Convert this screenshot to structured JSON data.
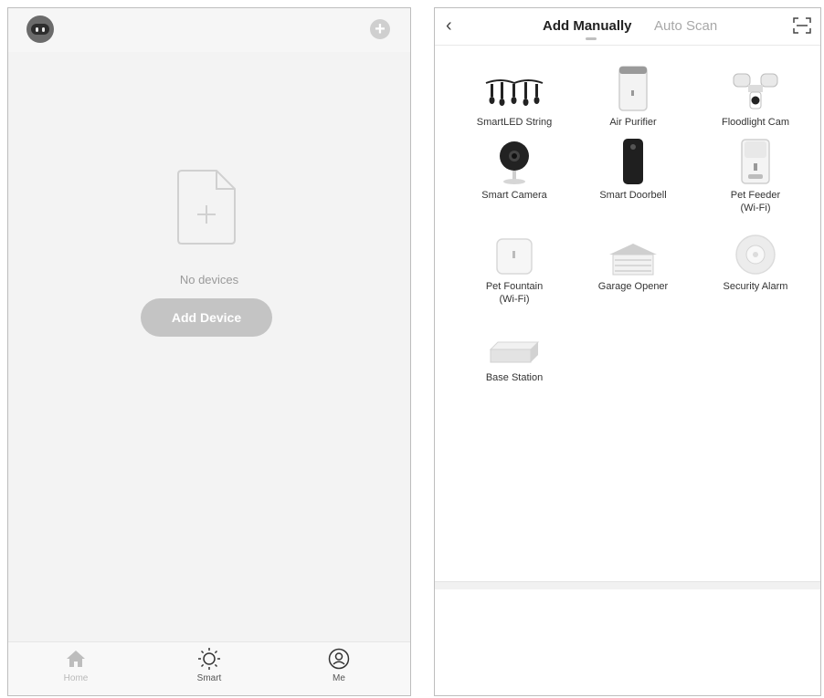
{
  "left_screen": {
    "top_bar": {
      "avatar": "robot-avatar-icon",
      "add_icon": "plus-circle-icon"
    },
    "empty_state": {
      "icon": "add-document-icon",
      "message": "No devices"
    },
    "add_device_button": "Add Device",
    "tab_bar": [
      {
        "label": "Home",
        "icon": "home-icon"
      },
      {
        "label": "Smart",
        "icon": "sun-icon"
      },
      {
        "label": "Me",
        "icon": "user-icon"
      }
    ]
  },
  "right_screen": {
    "header": {
      "back_icon": "chevron-left-icon",
      "active_tab": "Add Manually",
      "inactive_tab": "Auto Scan",
      "scan_icon": "scan-frame-icon"
    },
    "devices": [
      {
        "label": "SmartLED String",
        "icon": "string-lights-icon"
      },
      {
        "label": "Air Purifier",
        "icon": "air-purifier-icon"
      },
      {
        "label": "Floodlight Cam",
        "icon": "floodlight-cam-icon"
      },
      {
        "label": "Smart Camera",
        "icon": "smart-camera-icon"
      },
      {
        "label": "Smart Doorbell",
        "icon": "doorbell-icon"
      },
      {
        "label": "Pet Feeder\n(Wi-Fi)",
        "icon": "pet-feeder-icon"
      },
      {
        "label": "Pet Fountain\n(Wi-Fi)",
        "icon": "pet-fountain-icon"
      },
      {
        "label": "Garage Opener",
        "icon": "garage-icon"
      },
      {
        "label": "Security Alarm",
        "icon": "alarm-icon"
      },
      {
        "label": "Base Station",
        "icon": "base-station-icon"
      }
    ]
  }
}
